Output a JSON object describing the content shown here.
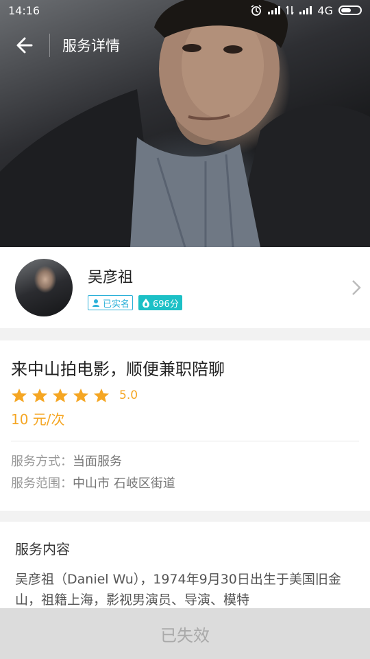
{
  "status_bar": {
    "time": "14:16",
    "network": "4G"
  },
  "nav": {
    "title": "服务详情"
  },
  "profile": {
    "name": "吴彦祖",
    "verified_label": "已实名",
    "score_label": "696分"
  },
  "service": {
    "title": "来中山拍电影，顺便兼职陪聊",
    "rating": 5.0,
    "rating_text": "5.0",
    "price": "10 元/次",
    "method_label": "服务方式：",
    "method_value": "当面服务",
    "range_label": "服务范围：",
    "range_value": "中山市 石岐区街道"
  },
  "content": {
    "heading": "服务内容",
    "body": "吴彦祖（Daniel Wu），1974年9月30日出生于美国旧金山，祖籍上海，影视男演员、导演、模特"
  },
  "bottom": {
    "status_label": "已失效"
  },
  "colors": {
    "accent": "#f5a623",
    "verified": "#2bb0d8",
    "score": "#1cc0c6"
  }
}
